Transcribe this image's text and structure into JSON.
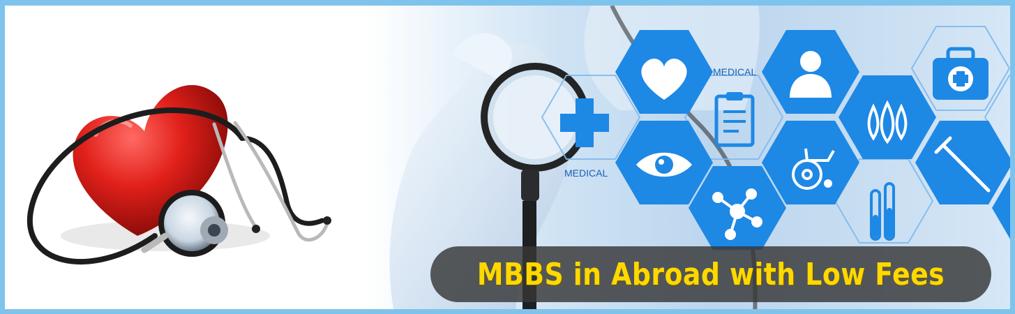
{
  "banner": {
    "caption": "MBBS in Abroad with Low Fees",
    "labels": [
      "MEDICAL",
      "MEDICAL"
    ],
    "colors": {
      "frame": "#7ec3ec",
      "hex_fill": "#1e88e5",
      "caption_text": "#ffd800",
      "caption_bg": "#373737"
    },
    "icons": [
      "heart-icon",
      "person-icon",
      "clipboard-icon",
      "first-aid-kit-icon",
      "medical-cross-icon",
      "eye-icon",
      "water-drops-icon",
      "molecule-icon",
      "wheelchair-icon",
      "syringe-icon",
      "test-tubes-icon"
    ]
  }
}
